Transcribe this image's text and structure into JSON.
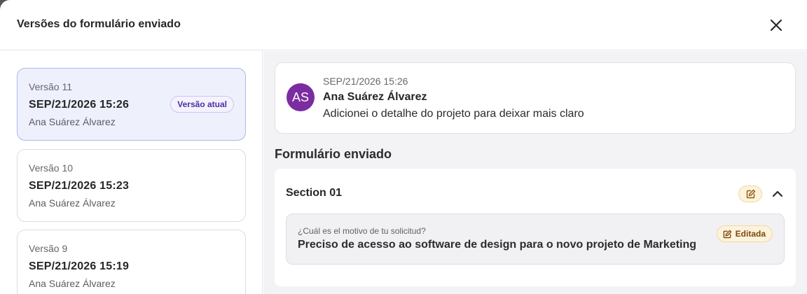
{
  "dialog": {
    "title": "Versões do formulário enviado"
  },
  "versions": [
    {
      "label": "Versão 11",
      "date": "SEP/21/2026 15:26",
      "author": "Ana Suárez Álvarez",
      "badge": "Versão atual"
    },
    {
      "label": "Versão 10",
      "date": "SEP/21/2026 15:23",
      "author": "Ana Suárez Álvarez"
    },
    {
      "label": "Versão 9",
      "date": "SEP/21/2026 15:19",
      "author": "Ana Suárez Álvarez"
    }
  ],
  "comment": {
    "initials": "AS",
    "time": "SEP/21/2026 15:26",
    "author": "Ana Suárez Álvarez",
    "text": "Adicionei o detalhe do projeto para deixar mais claro"
  },
  "form": {
    "heading": "Formulário enviado",
    "section_title": "Section 01",
    "question": "¿Cuál es el motivo de tu solicitud?",
    "answer": "Preciso de acesso ao software de design para o novo projeto de Marketing",
    "edited_label": "Editada"
  },
  "colors": {
    "accent": "#4b2fa3",
    "avatar": "#7b2ca1",
    "edited_bg": "#fdf3dc"
  }
}
